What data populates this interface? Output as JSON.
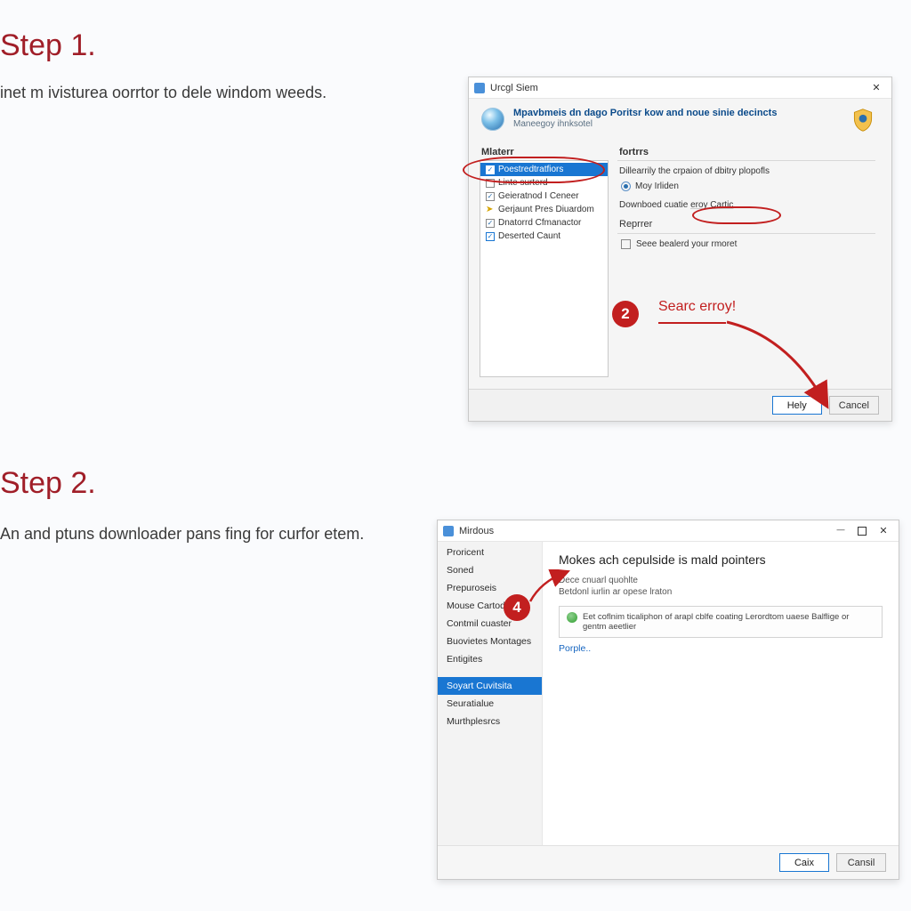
{
  "step1": {
    "heading": "Step 1.",
    "body": "inet m ivisturea oorrtor to dele windom weeds."
  },
  "step2": {
    "heading": "Step 2.",
    "body": "An and ptuns downloader pans fing for curfor etem."
  },
  "annotations": {
    "badge2": "2",
    "badge4": "4",
    "step1_arrow_label": "Searc erroy!"
  },
  "dialog1": {
    "title": "Urcgl Siem",
    "header_title": "Mpavbmeis dn dago Poritsr kow and noue sinie decincts",
    "header_subtitle": "Maneegoy ihnksotel",
    "left_col_heading": "Mlaterr",
    "tree": [
      {
        "label": "Poestredtratfiors",
        "selected": true,
        "icon": "checkbox"
      },
      {
        "label": "Linte surterd",
        "icon": "checkbox"
      },
      {
        "label": "Geieratnod I Ceneer",
        "icon": "checkbox"
      },
      {
        "label": "Gerjaunt Pres Diuardom",
        "icon": "arrow"
      },
      {
        "label": "Dnatorrd Cfmanactor",
        "icon": "checkbox"
      },
      {
        "label": "Deserted Caunt",
        "icon": "checkbox-checked"
      }
    ],
    "right_col_heading": "fortrrs",
    "right_desc": "Dillearrily the crpaion of dbitry plopofls",
    "radio_label": "Moy Irliden",
    "download_row_prefix": "Downboed cuatie ",
    "download_row_link": "eroy Cartic",
    "repeat_heading": "Reprrer",
    "repeat_check_label": "Seee bealerd your rmoret",
    "buttons": {
      "help": "Hely",
      "cancel": "Cancel"
    }
  },
  "dialog2": {
    "title": "Mirdous",
    "sidebar": [
      "Proricent",
      "Soned",
      "Prepuroseis",
      "Mouse Cartodi",
      "Contmil cuaster",
      "Buovietes Montages",
      "Entigites"
    ],
    "sidebar_group2": [
      "Soyart Cuvitsita",
      "Seuratialue",
      "Murthplesrcs"
    ],
    "content_title": "Mokes ach cepulside is mald pointers",
    "content_sub1": "Dece cnuarl quohlte",
    "content_sub2": "Betdonl iurlin ar opese lraton",
    "infobox_text": "Eet coflnim ticaliphon of arapl cblfe coating Lerordtom uaese Balflige or gentm aeetlier",
    "people_link": "Porple..",
    "buttons": {
      "ok": "Caix",
      "cancel": "Cansil"
    }
  }
}
